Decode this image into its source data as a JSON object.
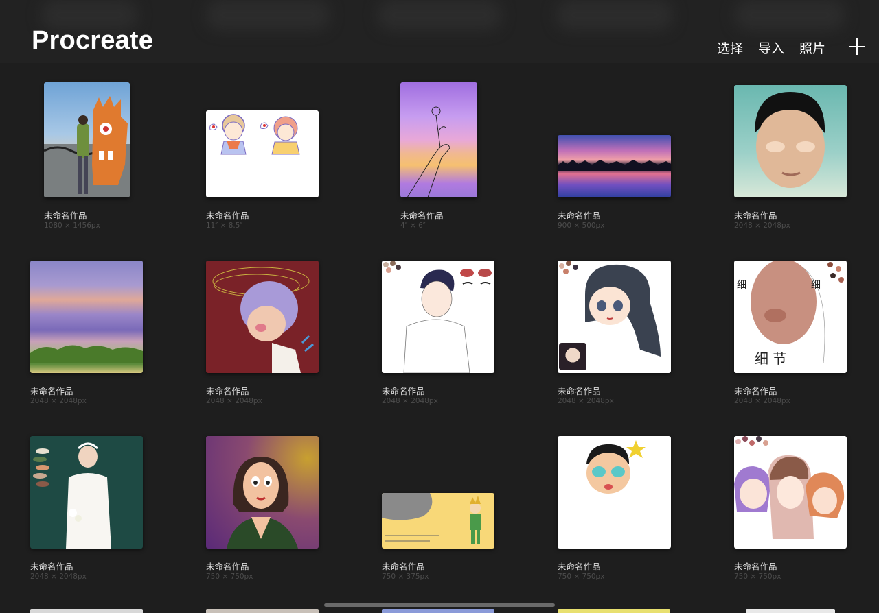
{
  "header": {
    "app_title": "Procreate",
    "select_label": "选择",
    "import_label": "导入",
    "photos_label": "照片",
    "new_icon": "plus-icon"
  },
  "artworks": [
    {
      "title": "未命名作品",
      "size": "1080 × 1456px"
    },
    {
      "title": "未命名作品",
      "size": "11″ × 8.5″"
    },
    {
      "title": "未命名作品",
      "size": "4″ × 6″"
    },
    {
      "title": "未命名作品",
      "size": "900 × 500px"
    },
    {
      "title": "未命名作品",
      "size": "2048 × 2048px"
    },
    {
      "title": "未命名作品",
      "size": "2048 × 2048px"
    },
    {
      "title": "未命名作品",
      "size": "2048 × 2048px"
    },
    {
      "title": "未命名作品",
      "size": "2048 × 2048px"
    },
    {
      "title": "未命名作品",
      "size": "2048 × 2048px"
    },
    {
      "title": "未命名作品",
      "size": "2048 × 2048px"
    },
    {
      "title": "未命名作品",
      "size": "2048 × 2048px"
    },
    {
      "title": "未命名作品",
      "size": "750 × 750px"
    },
    {
      "title": "未命名作品",
      "size": "750 × 375px"
    },
    {
      "title": "未命名作品",
      "size": "750 × 750px"
    },
    {
      "title": "未命名作品",
      "size": "750 × 750px"
    }
  ],
  "colors": {
    "background": "#1e1e1e",
    "header": "#222222",
    "title_text": "#ffffff",
    "caption_text": "#dcdcdc",
    "meta_text": "#4c4c4c"
  }
}
